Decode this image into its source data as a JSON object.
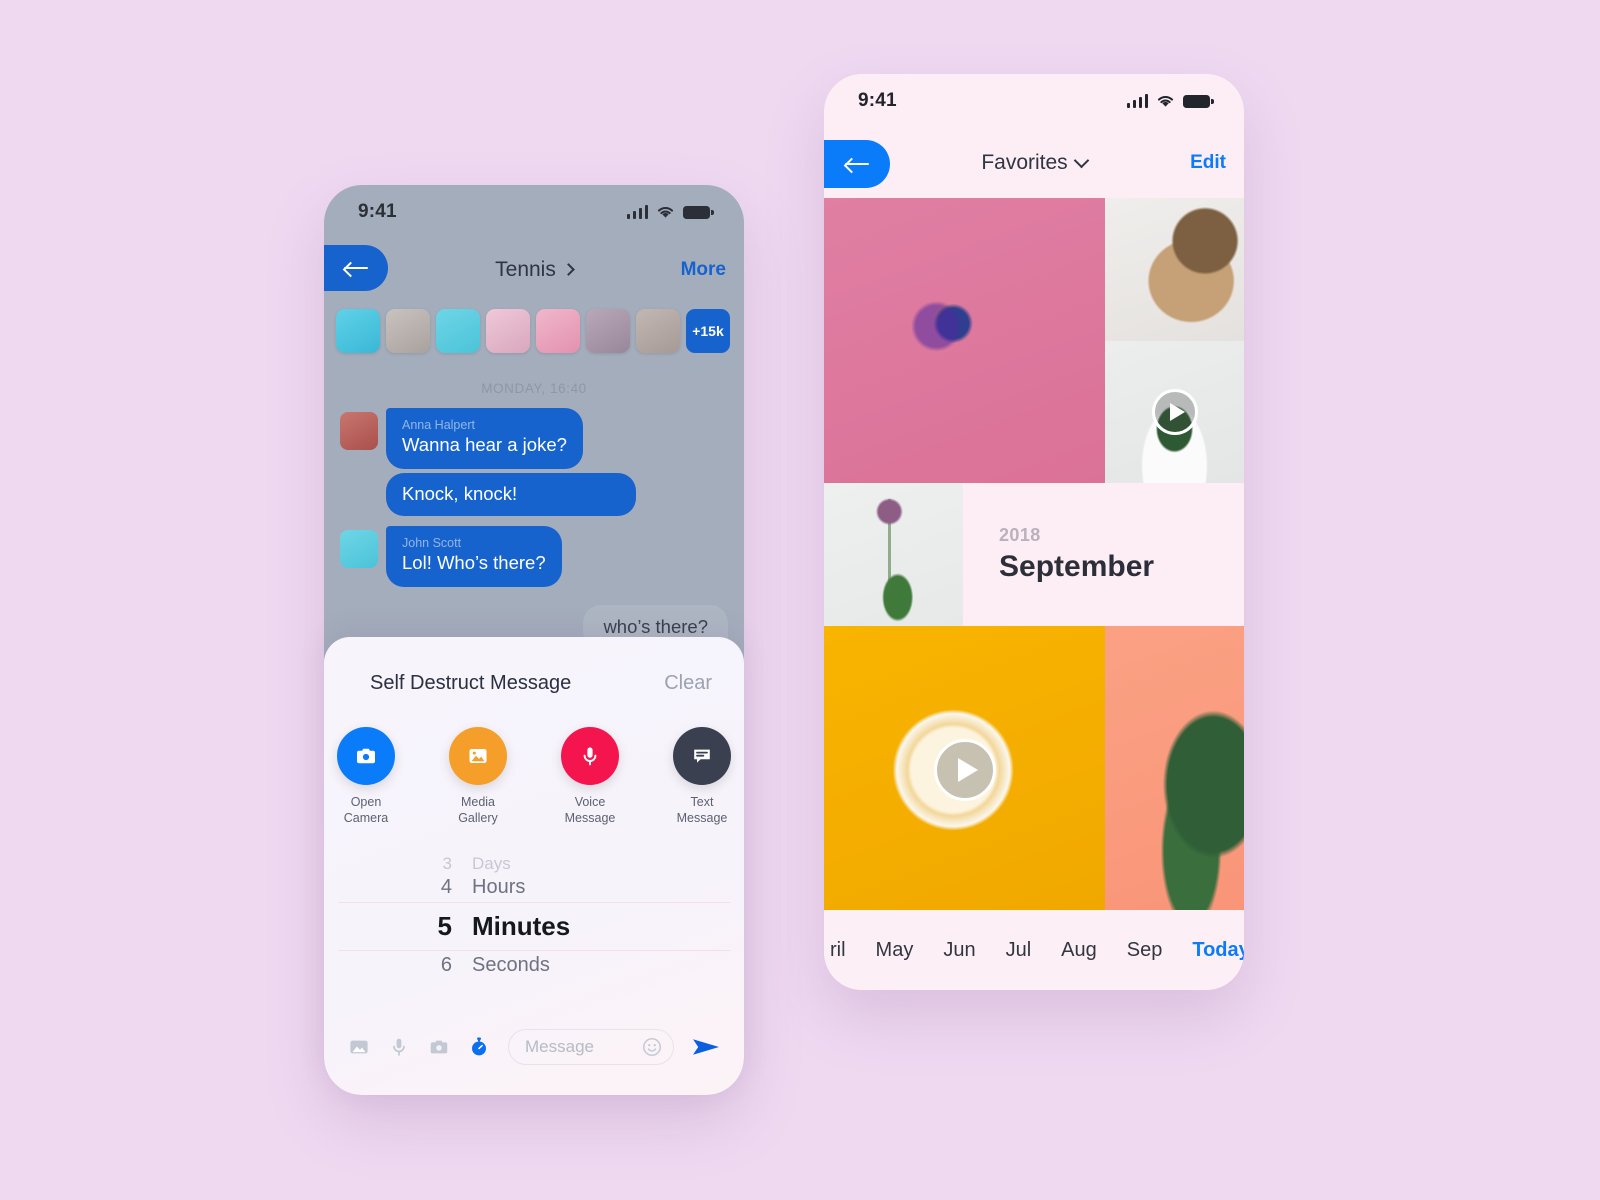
{
  "background_color": "#efd9f1",
  "chat_phone": {
    "status": {
      "time": "9:41",
      "signal_icon": "cellular-signal-icon",
      "wifi_icon": "wifi-icon",
      "battery_icon": "battery-icon"
    },
    "nav": {
      "back_icon": "arrow-left-icon",
      "title": "Tennis",
      "title_chevron_icon": "chevron-right-icon",
      "action": "More"
    },
    "participants": {
      "count_badge": "+15k",
      "avatars": [
        "avatar-1",
        "avatar-2",
        "avatar-3",
        "avatar-4",
        "avatar-5",
        "avatar-6",
        "avatar-7"
      ]
    },
    "daystamp": "MONDAY, 16:40",
    "messages": [
      {
        "sender": "Anna Halpert",
        "text": "Wanna hear a joke?",
        "side": "in"
      },
      {
        "sender": "",
        "text": "Knock, knock!",
        "side": "in"
      },
      {
        "sender": "John Scott",
        "text": "Lol! Who’s there?",
        "side": "in"
      },
      {
        "sender": "",
        "text": "who’s there?",
        "side": "out"
      }
    ],
    "sheet": {
      "title": "Self Destruct Message",
      "clear_label": "Clear",
      "actions": [
        {
          "label_line1": "Open",
          "label_line2": "Camera",
          "icon": "camera-icon",
          "color": "#0a7cfa"
        },
        {
          "label_line1": "Media",
          "label_line2": "Gallery",
          "icon": "image-icon",
          "color": "#f59e2a"
        },
        {
          "label_line1": "Voice",
          "label_line2": "Message",
          "icon": "microphone-icon",
          "color": "#f5154e"
        },
        {
          "label_line1": "Text",
          "label_line2": "Message",
          "icon": "chat-bubble-icon",
          "color": "#3a4050"
        }
      ],
      "picker": [
        {
          "value": "3",
          "unit": "Days"
        },
        {
          "value": "4",
          "unit": "Hours"
        },
        {
          "value": "5",
          "unit": "Minutes"
        },
        {
          "value": "6",
          "unit": "Seconds"
        }
      ],
      "selected_index": 2
    },
    "inputbar": {
      "icons": [
        "image-icon",
        "microphone-icon",
        "camera-icon",
        "timer-icon"
      ],
      "placeholder": "Message",
      "emoji_icon": "smiley-icon",
      "send_icon": "send-icon"
    }
  },
  "photos_phone": {
    "status": {
      "time": "9:41",
      "signal_icon": "cellular-signal-icon",
      "wifi_icon": "wifi-icon",
      "battery_icon": "battery-icon"
    },
    "nav": {
      "back_icon": "arrow-left-icon",
      "title": "Favorites",
      "title_chevron_icon": "chevron-down-icon",
      "action": "Edit"
    },
    "album": {
      "year": "2018",
      "month": "September"
    },
    "tiles": [
      {
        "name": "photo-pink-ship",
        "video": false
      },
      {
        "name": "photo-woman-hat",
        "video": false
      },
      {
        "name": "photo-cactus-pot",
        "video": true
      },
      {
        "name": "photo-flower-bud",
        "video": false
      },
      {
        "name": "photo-lemon-yellow",
        "video": true
      },
      {
        "name": "photo-succulent-peach",
        "video": false
      }
    ],
    "months": [
      "ril",
      "May",
      "Jun",
      "Jul",
      "Aug",
      "Sep"
    ],
    "today_label": "Today"
  }
}
